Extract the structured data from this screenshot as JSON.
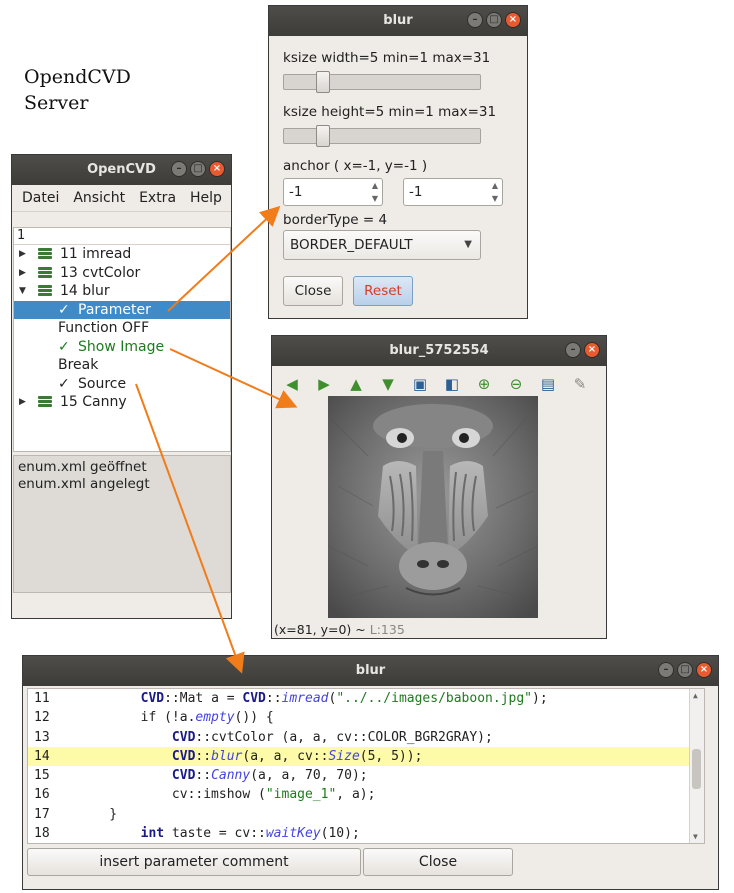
{
  "caption": {
    "line1": "OpendCVD",
    "line2": "Server"
  },
  "blur_window": {
    "title": "blur",
    "ksize_width_label": "ksize width=5  min=1  max=31",
    "ksize_width_level": 0.13,
    "ksize_height_label": "ksize height=5  min=1  max=31",
    "ksize_height_level": 0.13,
    "anchor_label": "anchor ( x=-1, y=-1 )",
    "anchor_x": "-1",
    "anchor_y": "-1",
    "border_type_label": "borderType = 4",
    "border_type_value": "BORDER_DEFAULT",
    "close_label": "Close",
    "reset_label": "Reset"
  },
  "main_window": {
    "title": "OpenCVD",
    "menu": [
      "Datei",
      "Ansicht",
      "Extra",
      "Help"
    ],
    "tree_header": "1",
    "tree": [
      {
        "kind": "node",
        "expanded": false,
        "label": "11 imread"
      },
      {
        "kind": "node",
        "expanded": false,
        "label": "13 cvtColor"
      },
      {
        "kind": "node",
        "expanded": true,
        "label": "14 blur"
      },
      {
        "kind": "check",
        "label": "Parameter",
        "selected": true
      },
      {
        "kind": "plain",
        "label": "Function OFF"
      },
      {
        "kind": "check",
        "label": "Show Image",
        "green": true
      },
      {
        "kind": "plain",
        "label": "Break"
      },
      {
        "kind": "check",
        "label": "Source"
      },
      {
        "kind": "node",
        "expanded": false,
        "label": "15 Canny"
      }
    ],
    "log": [
      "enum.xml geöffnet",
      "enum.xml angelegt"
    ]
  },
  "image_window": {
    "title": "blur_5752554",
    "toolbar_icons": [
      "arrow-left-icon",
      "arrow-right-icon",
      "arrow-up-icon",
      "arrow-down-icon",
      "image-icon",
      "zoom-fit-icon",
      "zoom-in-icon",
      "zoom-out-icon",
      "save-icon",
      "brush-icon"
    ],
    "status_coords": "(x=81, y=0) ~",
    "status_level": "L:135"
  },
  "code_window": {
    "title": "blur",
    "lines": [
      {
        "n": "11",
        "parts": [
          [
            "",
            "        "
          ],
          [
            "kw",
            "CVD"
          ],
          [
            "",
            "::Mat a = "
          ],
          [
            "kw",
            "CVD"
          ],
          [
            "",
            "::"
          ],
          [
            "fn",
            "imread"
          ],
          [
            "",
            "("
          ],
          [
            "st",
            "\"../../images/baboon.jpg\""
          ],
          [
            "",
            ");"
          ]
        ]
      },
      {
        "n": "12",
        "parts": [
          [
            "",
            "        if (!a."
          ],
          [
            "fn",
            "empty"
          ],
          [
            "",
            "()) {"
          ]
        ]
      },
      {
        "n": "13",
        "parts": [
          [
            "",
            "            "
          ],
          [
            "kw",
            "CVD"
          ],
          [
            "",
            "::cvtColor (a, a, cv::COLOR_BGR2GRAY);"
          ]
        ]
      },
      {
        "n": "14",
        "hl": true,
        "parts": [
          [
            "",
            "            "
          ],
          [
            "kw",
            "CVD"
          ],
          [
            "",
            "::"
          ],
          [
            "fn",
            "blur"
          ],
          [
            "",
            "(a, a, cv::"
          ],
          [
            "fn",
            "Size"
          ],
          [
            "",
            "(5, 5));"
          ]
        ]
      },
      {
        "n": "15",
        "parts": [
          [
            "",
            "            "
          ],
          [
            "kw",
            "CVD"
          ],
          [
            "",
            "::"
          ],
          [
            "fn",
            "Canny"
          ],
          [
            "",
            "(a, a, 70, 70);"
          ]
        ]
      },
      {
        "n": "16",
        "parts": [
          [
            "",
            "            cv::imshow ("
          ],
          [
            "st",
            "\"image_1\""
          ],
          [
            "",
            ", a);"
          ]
        ]
      },
      {
        "n": "17",
        "parts": [
          [
            "",
            "    }"
          ]
        ]
      },
      {
        "n": "18",
        "parts": [
          [
            "",
            "        "
          ],
          [
            "kw",
            "int"
          ],
          [
            "",
            " taste = cv::"
          ],
          [
            "fn",
            "waitKey"
          ],
          [
            "",
            "(10);"
          ]
        ]
      }
    ],
    "insert_label": "insert parameter comment",
    "close_label": "Close"
  },
  "colors": {
    "arrow": "#f07c1a",
    "selection": "#3f8ac7",
    "highlight": "#fdfaa8"
  }
}
